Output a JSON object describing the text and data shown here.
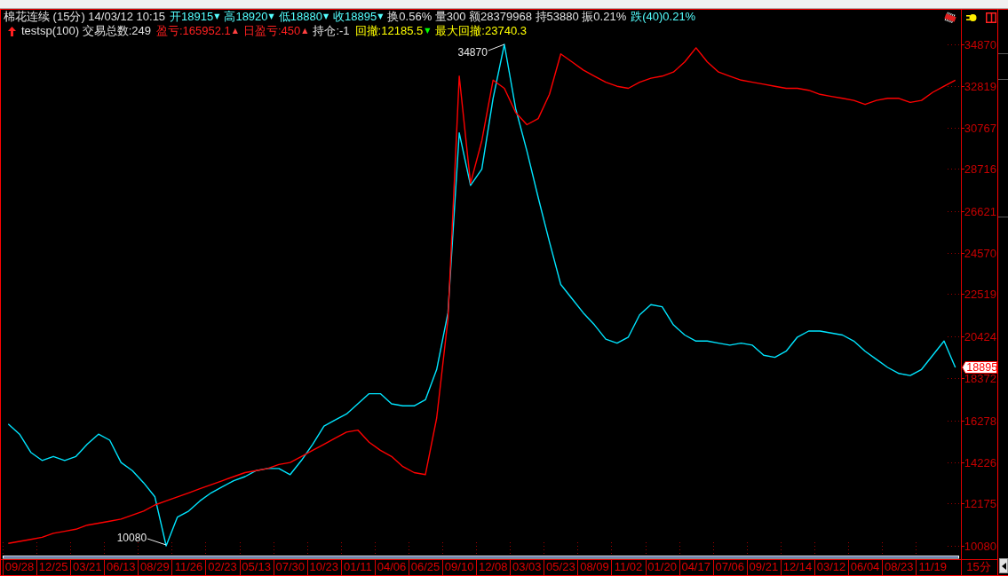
{
  "quote_line": [
    {
      "kind": "text",
      "text": "棉花连续 (15分) 14/03/12 10:15",
      "color": "#e0e0e0"
    },
    {
      "kind": "text",
      "text": "开18915",
      "color": "#55ffff"
    },
    {
      "kind": "marker",
      "text": "▼",
      "color": "#55ffff"
    },
    {
      "kind": "text",
      "text": "高18920",
      "color": "#55ffff"
    },
    {
      "kind": "marker",
      "text": "▼",
      "color": "#55ffff"
    },
    {
      "kind": "text",
      "text": "低18880",
      "color": "#55ffff"
    },
    {
      "kind": "marker",
      "text": "▼",
      "color": "#55ffff"
    },
    {
      "kind": "text",
      "text": "收18895",
      "color": "#55ffff"
    },
    {
      "kind": "marker",
      "text": "▼",
      "color": "#55ffff"
    },
    {
      "kind": "text",
      "text": "换0.56% 量300 额28379968 持53880 振0.21%",
      "color": "#e0e0e0"
    },
    {
      "kind": "text",
      "text": "跌(40)0.21%",
      "color": "#55ffff"
    }
  ],
  "strategy_line": [
    {
      "kind": "text",
      "text": "testsp(100) 交易总数:249",
      "color": "#e0e0e0"
    },
    {
      "kind": "text",
      "text": "盈亏:165952.1",
      "color": "#ff2020"
    },
    {
      "kind": "marker",
      "text": "▲",
      "color": "#ff4040"
    },
    {
      "kind": "text",
      "text": "日盈亏:450",
      "color": "#ff2020"
    },
    {
      "kind": "marker",
      "text": "▲",
      "color": "#ff4040"
    },
    {
      "kind": "text",
      "text": "持仓:-1",
      "color": "#e0e0e0"
    },
    {
      "kind": "text",
      "text": "回撤:12185.5",
      "color": "#ffff00"
    },
    {
      "kind": "marker",
      "text": "▼",
      "color": "#00ff00"
    },
    {
      "kind": "text",
      "text": "最大回撤:23740.3",
      "color": "#ffff00"
    }
  ],
  "chart": {
    "chart_data": {
      "type": "line",
      "categories": [
        null,
        "09/28",
        null,
        null,
        "12/25",
        null,
        null,
        "03/21",
        null,
        null,
        "06/13",
        null,
        null,
        "08/29",
        null,
        null,
        "11/26",
        null,
        null,
        "02/23",
        null,
        null,
        "05/13",
        null,
        null,
        "07/30",
        null,
        null,
        "10/23",
        null,
        null,
        "01/11",
        null,
        null,
        "04/06",
        null,
        null,
        "06/25",
        null,
        null,
        "09/10",
        null,
        null,
        "12/08",
        null,
        null,
        "03/03",
        null,
        null,
        "05/23",
        null,
        null,
        "08/09",
        null,
        null,
        "11/02",
        null,
        null,
        "01/20",
        null,
        null,
        "04/17",
        null,
        null,
        "07/06",
        null,
        null,
        "09/21",
        null,
        null,
        "12/14",
        null,
        null,
        "03/12",
        null,
        null,
        "06/04",
        null,
        null,
        "08/23",
        null,
        null,
        "11/19",
        null,
        null
      ],
      "series": [
        {
          "color": "#00e5ff",
          "values": [
            16100,
            15600,
            14700,
            14300,
            14500,
            14300,
            14500,
            15100,
            15600,
            15300,
            14200,
            13800,
            13200,
            12500,
            10080,
            11500,
            11800,
            12300,
            12700,
            13000,
            13300,
            13500,
            13800,
            13900,
            13900,
            13600,
            14300,
            15100,
            16000,
            16300,
            16600,
            17100,
            17600,
            17600,
            17100,
            17000,
            17000,
            17300,
            18800,
            21600,
            30500,
            27900,
            28700,
            32200,
            34870,
            31700,
            29600,
            27300,
            25100,
            23000,
            22300,
            21600,
            21000,
            20300,
            20100,
            20400,
            21500,
            22000,
            21900,
            21000,
            20500,
            20200,
            20200,
            20100,
            20000,
            20100,
            20000,
            19500,
            19400,
            19700,
            20400,
            20700,
            20700,
            20600,
            20500,
            20200,
            19700,
            19300,
            18900,
            18600,
            18500,
            18800,
            19500,
            20200,
            18900
          ]
        },
        {
          "color": "#ff0000",
          "values": [
            10200,
            10300,
            10400,
            10500,
            10700,
            10800,
            10900,
            11100,
            11200,
            11300,
            11400,
            11600,
            11800,
            12100,
            12300,
            12500,
            12700,
            12900,
            13100,
            13300,
            13500,
            13700,
            13800,
            13900,
            14100,
            14200,
            14500,
            14800,
            15100,
            15400,
            15700,
            15800,
            15200,
            14800,
            14500,
            14000,
            13700,
            13600,
            16400,
            21300,
            33300,
            28000,
            30100,
            33100,
            32700,
            31500,
            30900,
            31200,
            32400,
            34400,
            34000,
            33600,
            33300,
            33000,
            32800,
            32700,
            33000,
            33200,
            33300,
            33500,
            34000,
            34700,
            34000,
            33500,
            33300,
            33100,
            33000,
            32900,
            32800,
            32700,
            32700,
            32600,
            32400,
            32300,
            32200,
            32100,
            31900,
            32100,
            32200,
            32200,
            32000,
            32100,
            32500,
            32800,
            33100
          ]
        }
      ],
      "ylim": [
        9641,
        36581
      ],
      "yticks": [
        10080,
        12175,
        14226,
        16278,
        18372,
        20424,
        22519,
        24570,
        26621,
        28716,
        30767,
        32819,
        34870
      ],
      "annotations": [
        "34870",
        "10080"
      ]
    },
    "last_price": "18895",
    "period": "15分"
  }
}
